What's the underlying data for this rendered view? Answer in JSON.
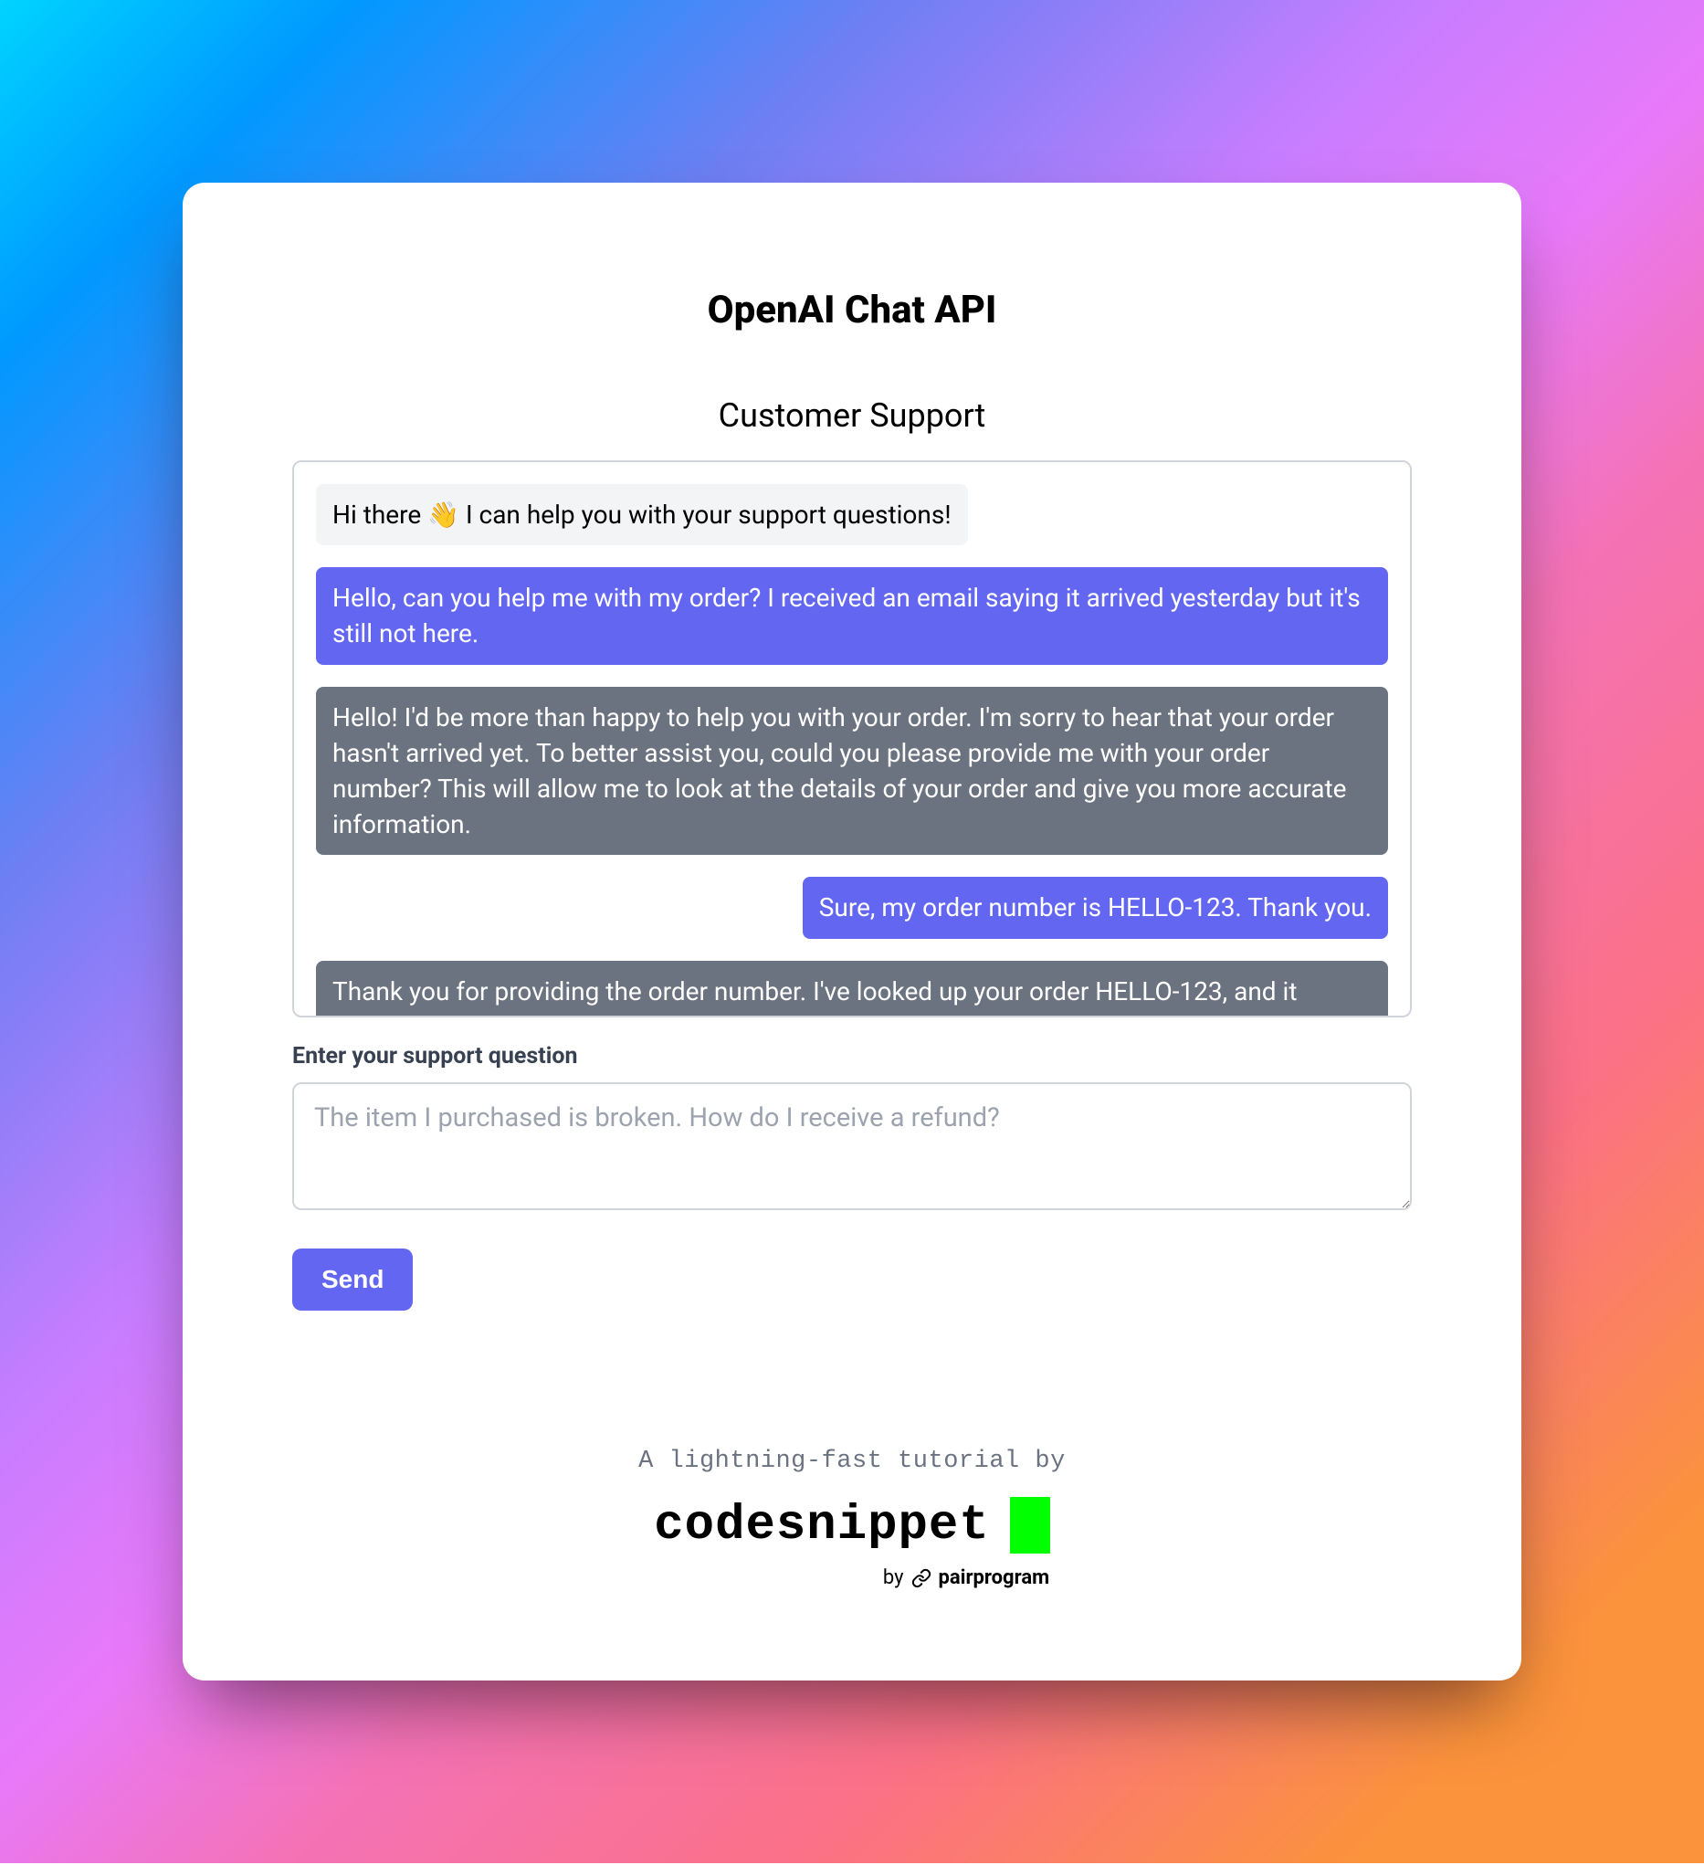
{
  "header": {
    "title": "OpenAI Chat API"
  },
  "chat": {
    "subtitle": "Customer Support",
    "messages": [
      {
        "role": "system",
        "text": "Hi there 👋 I can help you with your support questions!"
      },
      {
        "role": "user",
        "text": "Hello, can you help me with my order? I received an email saying it arrived yesterday but it's still not here."
      },
      {
        "role": "assistant",
        "text": "Hello! I'd be more than happy to help you with your order. I'm sorry to hear that your order hasn't arrived yet. To better assist you, could you please provide me with your order number? This will allow me to look at the details of your order and give you more accurate information."
      },
      {
        "role": "user",
        "text": "Sure, my order number is HELLO-123. Thank you."
      },
      {
        "role": "assistant",
        "text": "Thank you for providing the order number. I've looked up your order HELLO-123, and it appears that the package was marked as delivered yesterday. Sometimes carriers mark packages as delivered before they actually arrive at your doorstep, so it's possible it will arrive later today or"
      }
    ]
  },
  "form": {
    "label": "Enter your support question",
    "placeholder": "The item I purchased is broken. How do I receive a refund?",
    "send_label": "Send"
  },
  "footer": {
    "tagline": "A lightning-fast tutorial by",
    "logo_text": "codesnippet",
    "byline_prefix": "by",
    "byline_name": "pairprogram"
  }
}
